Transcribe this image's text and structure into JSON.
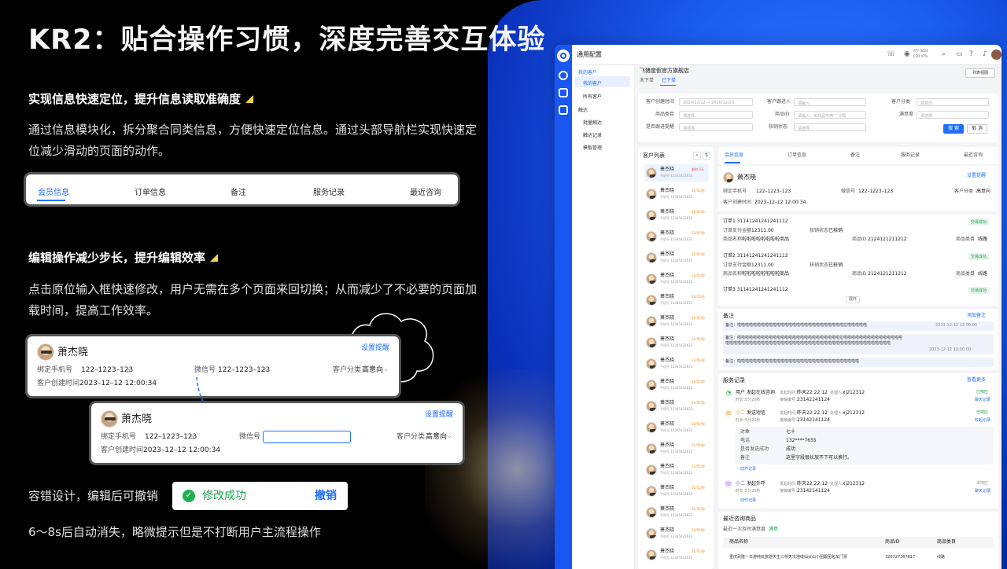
{
  "title": "KR2：贴合操作习惯，深度完善交互体验",
  "section1": {
    "heading": "实现信息快速定位，提升信息读取准确度",
    "body": "通过信息模块化，拆分聚合同类信息，方便快速定位信息。通过头部导航栏实现快速定位减少滑动的页面的动作。"
  },
  "tabs": [
    "会员信息",
    "订单信息",
    "备注",
    "服务记录",
    "最近咨询"
  ],
  "section2": {
    "heading": "编辑操作减少步长，提升编辑效率",
    "body": "点击原位输入框快速修改，用户无需在多个页面来回切换；从而减少了不必要的页面加载时间，提高工作效率。"
  },
  "card": {
    "name": "萧杰晓",
    "action": "设置提醒",
    "phone_label": "绑定手机号",
    "phone": "122–1223–123",
    "wechat_label": "微信号",
    "wechat": "122–1223–123",
    "category_label": "客户分类",
    "category": "高意向",
    "created_label": "客户创建时间",
    "created": "2023–12–12 12:00:34"
  },
  "undo": {
    "label": "容错设计，编辑后可撤销",
    "toast": "修改成功",
    "undo_btn": "撤销"
  },
  "footnote": "6～8s后自动消失，略微提示但是不打断用户主流程操作",
  "app": {
    "title": "通用配置",
    "header_status": [
      "ATT 4024",
      "CFD 47%"
    ],
    "list_view": "列表视图",
    "nav": [
      {
        "label": "我的客户"
      },
      {
        "label": "我的客户"
      },
      {
        "label": "所有客户"
      },
      {
        "label": "触达"
      },
      {
        "label": "批量触达"
      },
      {
        "label": "触达记录"
      },
      {
        "label": "模板管理"
      }
    ],
    "shop": "飞猪度假官方旗舰店",
    "subtabs": [
      "未下单",
      "已下单"
    ],
    "filters": [
      {
        "label": "客户创建时间",
        "ph": "2020/12/12  →  2020/12/23"
      },
      {
        "label": "客户跟进人",
        "ph": "请输入"
      },
      {
        "label": "客户分类",
        "ph": "高意向"
      },
      {
        "label": "商品类目",
        "ph": "请选择"
      },
      {
        "label": "商品ID",
        "ph": "请输入，多商品可用\",\"分隔"
      },
      {
        "label": "满意度",
        "ph": "请选择"
      },
      {
        "label": "是否跟进提醒",
        "ph": "请选择"
      },
      {
        "label": "核销状态",
        "ph": "请选择"
      }
    ],
    "search": "搜 索",
    "cancel": "取 消",
    "customer_list_title": "客户列表",
    "customers": [
      {
        "name": "萧杰晓",
        "phone": "手机号 12345432633",
        "time": "超时 3天"
      },
      {
        "name": "萧杰晓",
        "phone": "手机号 12345432633",
        "time": "22/05/秒"
      },
      {
        "name": "萧杰晓",
        "phone": "手机号 12345432633",
        "time": "22/05/秒"
      },
      {
        "name": "萧杰晓",
        "phone": "手机号 12345432633",
        "time": "22/05/秒"
      },
      {
        "name": "萧杰晓",
        "phone": "手机号 12345432633",
        "time": "22/05/秒"
      },
      {
        "name": "萧杰晓",
        "phone": "手机号 12345432633",
        "time": "22/05/秒"
      },
      {
        "name": "萧杰晓",
        "phone": "手机号 12345432633",
        "time": "22/05/秒"
      },
      {
        "name": "萧杰晓",
        "phone": "手机号 12345432633",
        "time": "22/05/秒"
      },
      {
        "name": "萧杰晓",
        "phone": "手机号 12345432633",
        "time": "22/05/秒"
      },
      {
        "name": "萧杰晓",
        "phone": "手机号 12345432633",
        "time": "22/05/秒"
      },
      {
        "name": "萧杰晓",
        "phone": "手机号 12345432633",
        "time": "22/05/秒"
      },
      {
        "name": "萧杰晓",
        "phone": "手机号 12345432633",
        "time": "22/05/秒"
      },
      {
        "name": "萧杰晓",
        "phone": "手机号 12345432633",
        "time": "22/05/秒"
      },
      {
        "name": "萧杰晓",
        "phone": "手机号 12345432633",
        "time": "22/05/秒"
      },
      {
        "name": "萧杰晓",
        "phone": "手机号 12345432633",
        "time": "22/05/秒"
      },
      {
        "name": "萧杰晓",
        "phone": "手机号 12345432633",
        "time": "22/05/秒"
      },
      {
        "name": "萧杰晓",
        "phone": "手机号 12345432633",
        "time": "22/05/秒"
      },
      {
        "name": "萧杰晓",
        "phone": "手机号 12345432633",
        "time": "22/05/秒"
      },
      {
        "name": "萧杰晓",
        "phone": "手机号 12345432633",
        "time": "22/05/秒"
      }
    ],
    "detail_tabs": [
      "会员信息",
      "订单信息",
      "备注",
      "服务记录",
      "最近咨询"
    ],
    "orders": [
      {
        "no": "订单1  31141241241241112",
        "pay_label": "订单支付金额",
        "pay": "12311.00",
        "verify_label": "核销状态",
        "verify": "已核销",
        "goods_label": "商品名称",
        "goods": "啦啦啦啦啦啦啦啦商品",
        "gid_label": "商品ID",
        "gid": "2124121211212",
        "cat_label": "商品类目",
        "cat": "线路",
        "tag": "交易成功"
      },
      {
        "no": "订单2  31141241241241112",
        "pay_label": "订单支付金额",
        "pay": "12311.00",
        "verify_label": "核销状态",
        "verify": "已核销",
        "goods_label": "商品名称",
        "goods": "啦啦啦啦啦啦啦啦商品",
        "gid_label": "商品ID",
        "gid": "2124121211212",
        "cat_label": "商品类目",
        "cat": "线路",
        "tag": "交易成功"
      },
      {
        "no": "订单3  31141241241241112",
        "tag": "交易成功"
      }
    ],
    "expand": "展开",
    "notes_title": "备注",
    "add_note": "添加备注",
    "notes": [
      {
        "text": "备注：啦啦啦啦啦啦啦啦啦啦啦啦啦啦啦啦啦啦啦啦啦啦啦啦啦啦啦拉啦啦啦啦啦",
        "time": "2023-12-12 12:00:00"
      },
      {
        "text": "备注：啦啦啦啦啦啦啦啦啦啦啦啦啦啦啦啦啦啦啦啦啦啦啦啦啦啦拉啦啦啦啦啦啦啦啦啦啦啦啦啦啦啦",
        "text2": "啦啦啦啦啦啦啦啦啦啦啦啦啦啦啦啦啦啦啦啦啦啦啦啦啦啦啦啦啦啦啦啦啦啦啦啦啦啦啦啦啦啦",
        "time": "2023-12-12 12:00:00"
      },
      {
        "text": "备注：啦啦啦啦啦啦啦啦啦啦啦啦啦啦啦啦啦啦啦啦啦啦啦啦啦啦啦啦啦啦啦"
      }
    ],
    "service_title": "服务记录",
    "see_more": "查看更多",
    "services": [
      {
        "who": "用户",
        "act": "发起在线咨询",
        "t_label": "发起时间：",
        "t": "昨天22:22:12",
        "h_label": "处理人：",
        "h": "xj212312",
        "d_label": "时长：",
        "d": "5分20秒",
        "n_label": "接触编号：",
        "n": "23142141124",
        "status": "已响应",
        "link": "聊天记录"
      },
      {
        "who": "小二",
        "act": "发送短信",
        "t_label": "发起时间：",
        "t": "昨天22:22:12",
        "h_label": "处理人：",
        "h": "xj212312",
        "d_label": "时长：",
        "d": "5分20秒",
        "n_label": "接触编号：",
        "n": "23142141124",
        "status": "已响应",
        "link": "收起记录"
      },
      {
        "who": "小二",
        "act": "发起外呼",
        "t_label": "发起时间：",
        "t": "昨天22:22:12",
        "h_label": "处理人：",
        "h": "xj212312",
        "d_label": "时长：",
        "d": "5分20秒",
        "n_label": "接触编号：",
        "n": "23142141124",
        "status": "未响应",
        "link": "聊天记录"
      }
    ],
    "sms": [
      {
        "k": "对象",
        "v": "七十"
      },
      {
        "k": "电话",
        "v": "132****7655"
      },
      {
        "k": "是否发送成功",
        "v": "成功"
      },
      {
        "k": "备注",
        "v": "这里字段很长放不下可以换行。"
      }
    ],
    "moving_record": "动作记录",
    "consult_title": "最近咨询商品",
    "consult_sub": "最近一次及时满意度",
    "consult_sat": "满意",
    "consult_cols": [
      "商品名称",
      "商品ID",
      "商品类目"
    ],
    "consult_row": [
      "重庆武隆一日游纯玩旅游天生三桥天坑地缝仙女山小团跟团包车门票",
      "326727367617",
      "线路"
    ]
  },
  "colors": {
    "accent": "#1e6fff",
    "success": "#20a050",
    "flag": "#f3d24b"
  }
}
